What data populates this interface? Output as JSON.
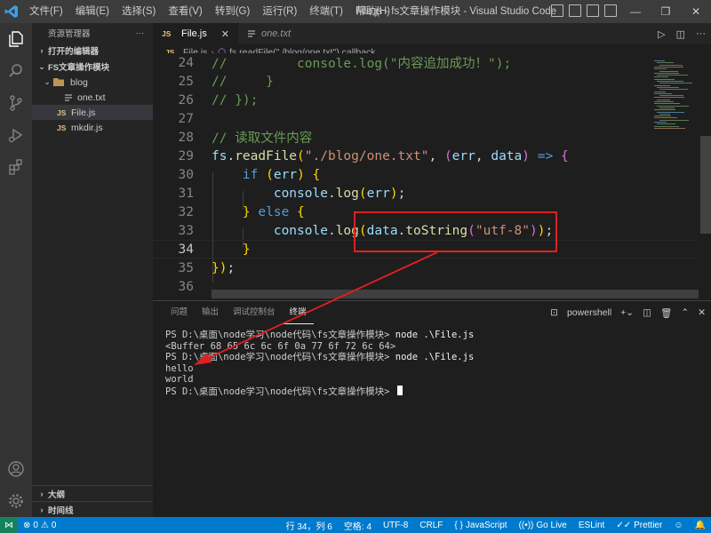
{
  "titlebar": {
    "menus": [
      "文件(F)",
      "编辑(E)",
      "选择(S)",
      "查看(V)",
      "转到(G)",
      "运行(R)",
      "终端(T)",
      "帮助(H)"
    ],
    "title": "File.js - fs文章操作模块 - Visual Studio Code"
  },
  "sidebar": {
    "header": "资源管理器",
    "open_editors": "打开的编辑器",
    "project": "FS文章操作模块",
    "folder": "blog",
    "items": {
      "one_txt": "one.txt",
      "file_js": "File.js",
      "mkdir_js": "mkdir.js"
    },
    "js_badge": "JS",
    "outline": "大纲",
    "timeline": "时间线"
  },
  "tabs": {
    "active": "File.js",
    "inactive": "one.txt"
  },
  "breadcrumb": {
    "file": "File.js",
    "symbol": "fs.readFile(\"./blog/one.txt\") callback"
  },
  "code": {
    "current_line": 34,
    "lines": [
      {
        "n": "24",
        "text": "//         console.log(\"内容追加成功！\");"
      },
      {
        "n": "25",
        "text": "//     }"
      },
      {
        "n": "26",
        "text": "// });"
      },
      {
        "n": "27",
        "text": ""
      },
      {
        "n": "28",
        "text": "// 读取文件内容"
      },
      {
        "n": "29",
        "text": "fs.readFile(\"./blog/one.txt\", (err, data) => {"
      },
      {
        "n": "30",
        "text": "    if (err) {"
      },
      {
        "n": "31",
        "text": "        console.log(err);"
      },
      {
        "n": "32",
        "text": "    } else {"
      },
      {
        "n": "33",
        "text": "        console.log(data.toString(\"utf-8\"));"
      },
      {
        "n": "34",
        "text": "    }"
      },
      {
        "n": "35",
        "text": "});"
      },
      {
        "n": "36",
        "text": ""
      }
    ]
  },
  "panel": {
    "tabs": [
      "问题",
      "输出",
      "调试控制台",
      "终端"
    ],
    "active_tab": "终端",
    "shell": "powershell",
    "terminal_lines": [
      {
        "prompt": "PS D:\\桌面\\node学习\\node代码\\fs文章操作模块> ",
        "cmd": "node .\\File.js"
      },
      {
        "prompt": "<Buffer 68 65 6c 6c 6f 0a 77 6f 72 6c 64>",
        "cmd": ""
      },
      {
        "prompt": "PS D:\\桌面\\node学习\\node代码\\fs文章操作模块> ",
        "cmd": "node .\\File.js"
      },
      {
        "prompt": "hello",
        "cmd": ""
      },
      {
        "prompt": "world",
        "cmd": ""
      },
      {
        "prompt": "PS D:\\桌面\\node学习\\node代码\\fs文章操作模块> ",
        "cmd": ""
      }
    ]
  },
  "statusbar": {
    "errors": "0",
    "warnings": "0",
    "position": "行 34，列 6",
    "spaces": "空格: 4",
    "encoding": "UTF-8",
    "eol": "CRLF",
    "language": "JavaScript",
    "golive": "Go Live",
    "eslint": "ESLint",
    "prettier": "Prettier"
  },
  "colors": {
    "accent": "#007acc",
    "annotation": "#e02020"
  }
}
